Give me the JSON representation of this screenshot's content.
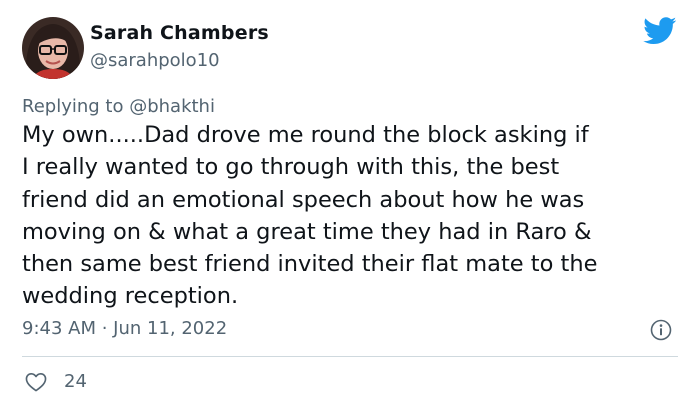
{
  "author": {
    "display_name": "Sarah Chambers",
    "handle": "@sarahpolo10",
    "avatar_icon": "profile-photo"
  },
  "reply": {
    "prefix": "Replying to ",
    "mention": "@bhakthi"
  },
  "tweet": {
    "text": "My own.....Dad drove me round the block asking if\nI really wanted to go through with this, the best\nfriend did an emotional speech about how he was\nmoving on & what a great time they had in Raro &\nthen same best friend invited their flat mate to the\nwedding reception.",
    "timestamp": "9:43 AM · Jun 11, 2022"
  },
  "actions": {
    "like_count": "24",
    "like_icon": "heart-icon",
    "info_icon": "info-icon"
  },
  "colors": {
    "brand": "#1d9bf0",
    "text": "#0f1419",
    "secondary": "#536471",
    "divider": "#cfd9de"
  }
}
